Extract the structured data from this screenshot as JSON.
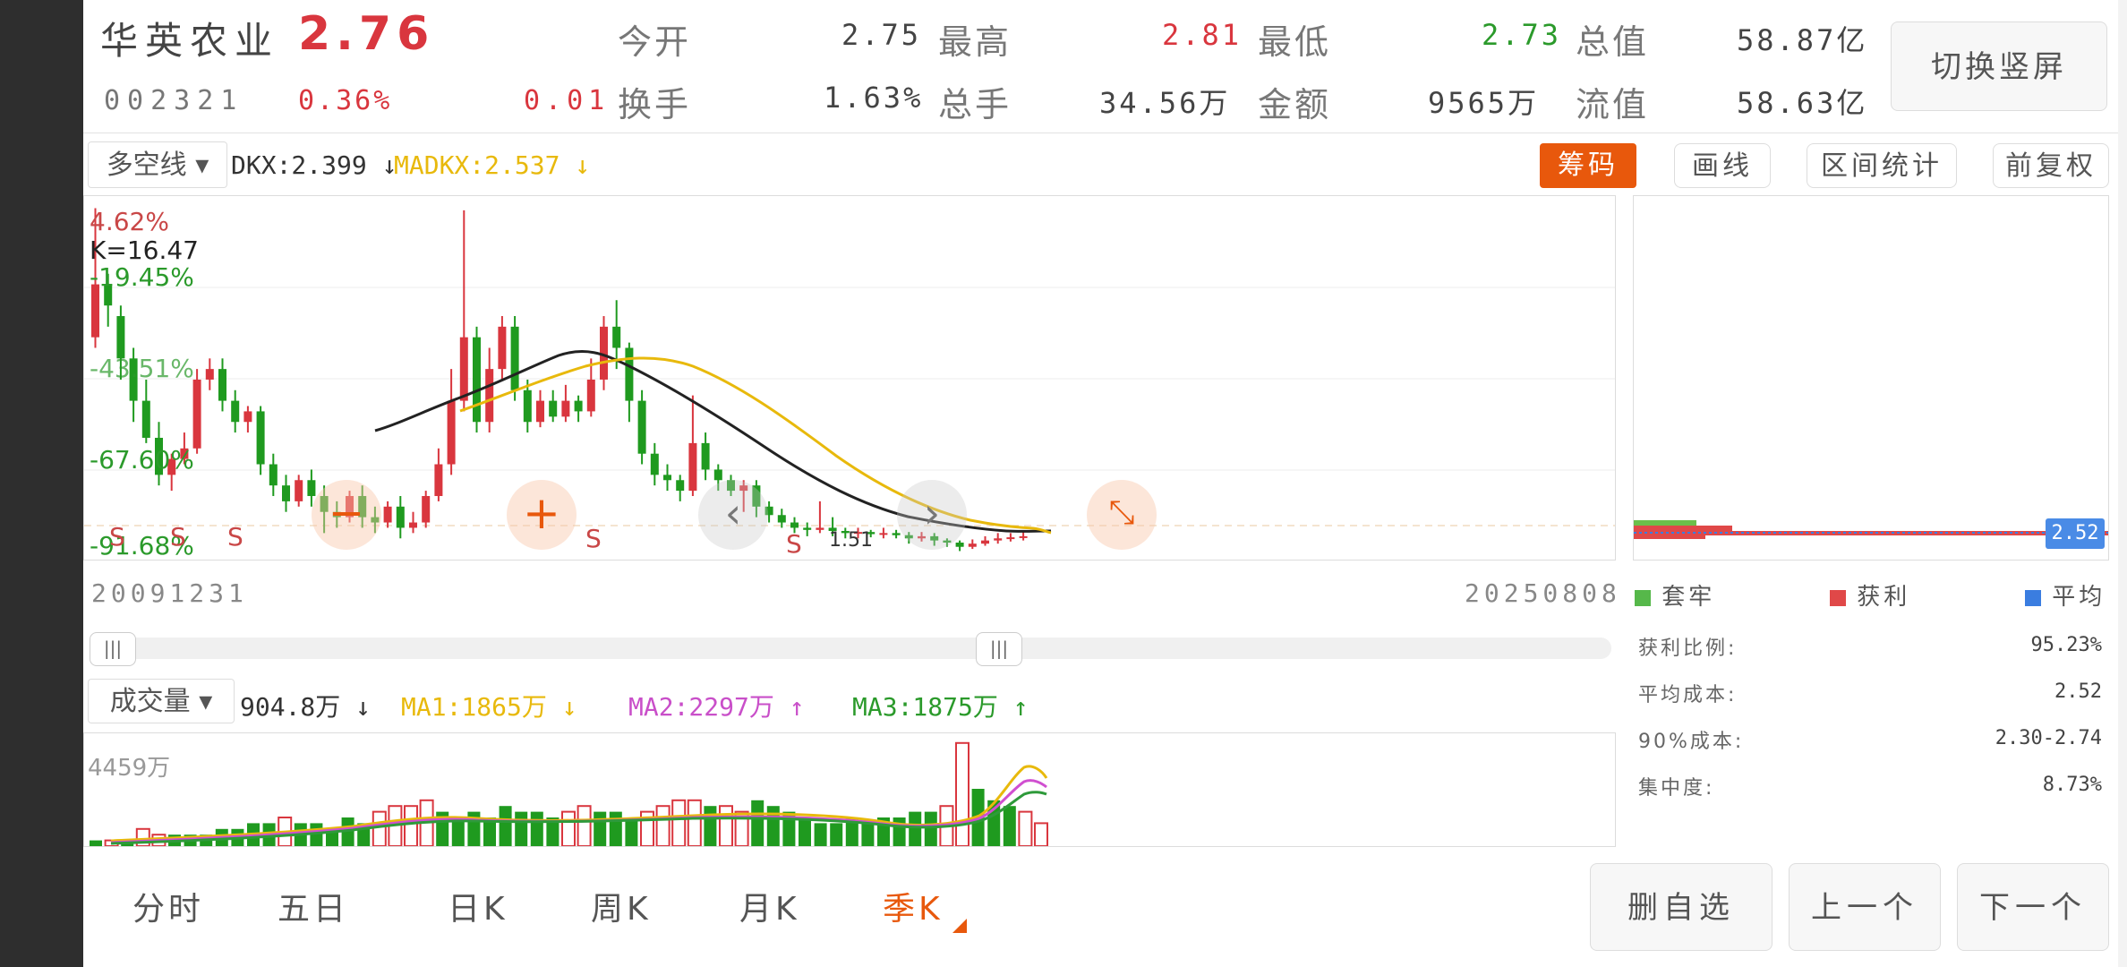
{
  "stock": {
    "name": "华英农业",
    "code": "002321",
    "price": "2.76",
    "change_pct": "0.36%",
    "change_amt": "0.01"
  },
  "quote": {
    "open_label": "今开",
    "open": "2.75",
    "high_label": "最高",
    "high": "2.81",
    "low_label": "最低",
    "low": "2.73",
    "mktcap_label": "总值",
    "mktcap": "58.87亿",
    "turnover_label": "换手",
    "turnover": "1.63%",
    "volume_label": "总手",
    "volume": "34.56万",
    "amount_label": "金额",
    "amount": "9565万",
    "float_label": "流值",
    "float": "58.63亿"
  },
  "switch_button": "切换竖屏",
  "indicator": {
    "select": "多空线",
    "dkx": "DKX:2.399 ↓",
    "madkx": "MADKX:2.537 ↓"
  },
  "toolbar": {
    "chips": "筹码",
    "draw": "画线",
    "range_stats": "区间统计",
    "adjust": "前复权"
  },
  "kchart": {
    "axis_labels": [
      "4.62%",
      "K=16.47",
      "-19.45%",
      "-43.51%",
      "-67.60%",
      "-91.68%"
    ],
    "start_date": "20091231",
    "end_date": "20250808",
    "s_marker": "S",
    "low_annot": "1.51"
  },
  "chips": {
    "price_tag": "2.52",
    "legend": {
      "trapped": "套牢",
      "profit": "获利",
      "average": "平均"
    },
    "stats": [
      {
        "label": "获利比例:",
        "value": "95.23%"
      },
      {
        "label": "平均成本:",
        "value": "2.52"
      },
      {
        "label": "90%成本:",
        "value": "2.30-2.74"
      },
      {
        "label": "集中度:",
        "value": "8.73%"
      }
    ]
  },
  "volume": {
    "select": "成交量",
    "current": "904.8万 ↓",
    "ma1": "MA1:1865万 ↓",
    "ma2": "MA2:2297万 ↑",
    "ma3": "MA3:1875万 ↑",
    "max_label": "4459万"
  },
  "tabs": [
    "分时",
    "五日",
    "日K",
    "周K",
    "月K",
    "季K"
  ],
  "active_tab": 5,
  "actions": {
    "delete_watch": "删自选",
    "prev": "上一个",
    "next": "下一个"
  },
  "colors": {
    "up": "#d9363e",
    "down": "#1f9a1f",
    "ma_yellow": "#e8b90c",
    "ma_pink": "#d04fd0",
    "ma_green": "#2e9a3a",
    "accent_orange": "#e8580c",
    "chip_blue": "#3a7de0"
  },
  "kline_candles": [
    [
      3.4,
      3.9,
      3.3,
      4.62
    ],
    [
      3.9,
      3.7,
      3.5,
      4.0
    ],
    [
      3.6,
      3.2,
      3.0,
      3.7
    ],
    [
      3.2,
      2.8,
      2.6,
      3.3
    ],
    [
      2.8,
      2.45,
      2.4,
      3.0
    ],
    [
      2.45,
      2.1,
      2.0,
      2.6
    ],
    [
      2.1,
      2.25,
      1.95,
      2.3
    ],
    [
      2.25,
      2.35,
      2.2,
      2.5
    ],
    [
      2.35,
      3.0,
      2.3,
      3.1
    ],
    [
      3.0,
      3.1,
      2.9,
      3.2
    ],
    [
      3.1,
      2.8,
      2.7,
      3.2
    ],
    [
      2.8,
      2.6,
      2.5,
      2.9
    ],
    [
      2.6,
      2.7,
      2.5,
      2.75
    ],
    [
      2.7,
      2.2,
      2.1,
      2.75
    ],
    [
      2.2,
      2.0,
      1.9,
      2.3
    ],
    [
      2.0,
      1.85,
      1.75,
      2.1
    ],
    [
      1.85,
      2.05,
      1.8,
      2.1
    ],
    [
      2.05,
      1.9,
      1.8,
      2.15
    ],
    [
      1.9,
      1.75,
      1.55,
      2.0
    ],
    [
      1.75,
      1.7,
      1.6,
      1.85
    ],
    [
      1.7,
      1.9,
      1.65,
      1.95
    ],
    [
      1.9,
      1.7,
      1.6,
      2.0
    ],
    [
      1.7,
      1.65,
      1.55,
      1.8
    ],
    [
      1.65,
      1.8,
      1.6,
      1.85
    ],
    [
      1.8,
      1.6,
      1.5,
      1.9
    ],
    [
      1.6,
      1.65,
      1.55,
      1.75
    ],
    [
      1.65,
      1.9,
      1.6,
      1.95
    ],
    [
      1.9,
      2.2,
      1.85,
      2.35
    ],
    [
      2.2,
      2.8,
      2.1,
      3.1
    ],
    [
      2.8,
      3.4,
      2.7,
      4.6
    ],
    [
      3.4,
      2.6,
      2.5,
      3.5
    ],
    [
      2.6,
      3.1,
      2.5,
      3.3
    ],
    [
      3.1,
      3.5,
      3.0,
      3.6
    ],
    [
      3.5,
      2.9,
      2.8,
      3.6
    ],
    [
      2.9,
      2.6,
      2.5,
      3.0
    ],
    [
      2.6,
      2.8,
      2.55,
      2.9
    ],
    [
      2.8,
      2.65,
      2.6,
      2.9
    ],
    [
      2.65,
      2.8,
      2.6,
      2.95
    ],
    [
      2.8,
      2.7,
      2.6,
      2.85
    ],
    [
      2.7,
      3.0,
      2.65,
      3.2
    ],
    [
      3.0,
      3.5,
      2.9,
      3.6
    ],
    [
      3.5,
      3.3,
      3.1,
      3.75
    ],
    [
      3.3,
      2.8,
      2.6,
      3.35
    ],
    [
      2.8,
      2.3,
      2.2,
      2.9
    ],
    [
      2.3,
      2.1,
      2.0,
      2.4
    ],
    [
      2.1,
      2.05,
      1.95,
      2.2
    ],
    [
      2.05,
      1.95,
      1.85,
      2.1
    ],
    [
      1.95,
      2.4,
      1.9,
      2.85
    ],
    [
      2.4,
      2.15,
      2.05,
      2.5
    ],
    [
      2.15,
      2.05,
      1.95,
      2.2
    ],
    [
      2.05,
      1.95,
      1.9,
      2.1
    ],
    [
      1.95,
      2.0,
      1.75,
      2.05
    ],
    [
      2.0,
      1.8,
      1.7,
      2.05
    ],
    [
      1.8,
      1.72,
      1.65,
      1.85
    ],
    [
      1.72,
      1.65,
      1.6,
      1.78
    ],
    [
      1.65,
      1.6,
      1.55,
      1.7
    ],
    [
      1.6,
      1.58,
      1.52,
      1.65
    ],
    [
      1.58,
      1.6,
      1.55,
      1.85
    ],
    [
      1.6,
      1.57,
      1.52,
      1.7
    ],
    [
      1.57,
      1.55,
      1.5,
      1.6
    ],
    [
      1.55,
      1.56,
      1.5,
      1.6
    ],
    [
      1.56,
      1.54,
      1.51,
      1.58
    ],
    [
      1.54,
      1.55,
      1.5,
      1.6
    ],
    [
      1.55,
      1.53,
      1.5,
      1.58
    ],
    [
      1.53,
      1.5,
      1.45,
      1.56
    ],
    [
      1.5,
      1.52,
      1.47,
      1.56
    ],
    [
      1.52,
      1.48,
      1.43,
      1.55
    ],
    [
      1.48,
      1.46,
      1.42,
      1.5
    ],
    [
      1.46,
      1.42,
      1.38,
      1.48
    ],
    [
      1.42,
      1.45,
      1.4,
      1.49
    ],
    [
      1.45,
      1.48,
      1.43,
      1.52
    ],
    [
      1.48,
      1.5,
      1.45,
      1.55
    ],
    [
      1.5,
      1.51,
      1.47,
      1.55
    ],
    [
      1.51,
      1.52,
      1.48,
      1.56
    ]
  ],
  "volume_bars": [
    [
      1,
      0
    ],
    [
      1,
      1
    ],
    [
      1,
      0
    ],
    [
      3,
      1
    ],
    [
      2,
      1
    ],
    [
      2,
      0
    ],
    [
      2,
      0
    ],
    [
      2,
      0
    ],
    [
      3,
      0
    ],
    [
      3,
      0
    ],
    [
      4,
      0
    ],
    [
      4,
      0
    ],
    [
      5,
      1
    ],
    [
      4,
      0
    ],
    [
      4,
      0
    ],
    [
      3,
      0
    ],
    [
      5,
      0
    ],
    [
      4,
      0
    ],
    [
      6,
      1
    ],
    [
      7,
      1
    ],
    [
      7,
      1
    ],
    [
      8,
      1
    ],
    [
      6,
      0
    ],
    [
      5,
      0
    ],
    [
      6,
      0
    ],
    [
      5,
      0
    ],
    [
      7,
      0
    ],
    [
      6,
      0
    ],
    [
      6,
      0
    ],
    [
      5,
      0
    ],
    [
      6,
      1
    ],
    [
      7,
      1
    ],
    [
      6,
      0
    ],
    [
      6,
      0
    ],
    [
      5,
      0
    ],
    [
      6,
      1
    ],
    [
      7,
      1
    ],
    [
      8,
      1
    ],
    [
      8,
      1
    ],
    [
      7,
      0
    ],
    [
      7,
      1
    ],
    [
      6,
      1
    ],
    [
      8,
      0
    ],
    [
      7,
      0
    ],
    [
      6,
      0
    ],
    [
      5,
      0
    ],
    [
      4,
      0
    ],
    [
      4,
      0
    ],
    [
      5,
      0
    ],
    [
      4,
      0
    ],
    [
      5,
      0
    ],
    [
      5,
      0
    ],
    [
      6,
      0
    ],
    [
      6,
      0
    ],
    [
      7,
      1
    ],
    [
      18,
      1
    ],
    [
      10,
      0
    ],
    [
      8,
      0
    ],
    [
      7,
      0
    ],
    [
      6,
      1
    ],
    [
      4,
      1
    ]
  ]
}
